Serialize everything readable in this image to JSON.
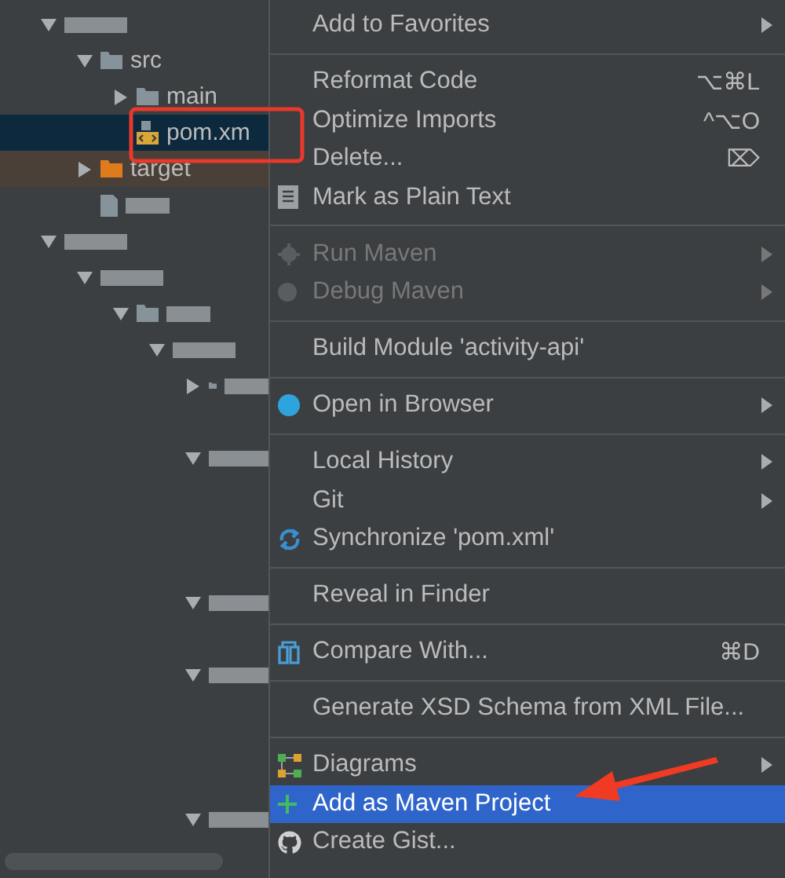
{
  "project_tree": [
    {
      "kind": "redacted",
      "expanded": true,
      "selected": false,
      "children": [
        {
          "kind": "folder",
          "label": "src",
          "expanded": true,
          "selected": false,
          "children": [
            {
              "kind": "folder",
              "label": "main",
              "expanded": false,
              "selected": false
            },
            {
              "kind": "maven-file",
              "label": "pom.xm",
              "selected": true
            }
          ]
        },
        {
          "kind": "excluded-folder",
          "label": "target",
          "expanded": false,
          "selected": false
        },
        {
          "kind": "redacted-file",
          "selected": false
        }
      ]
    },
    {
      "kind": "redacted",
      "expanded": true,
      "selected": false,
      "children": [
        {
          "kind": "redacted",
          "expanded": true,
          "selected": false,
          "children": [
            {
              "kind": "redacted-folder",
              "expanded": true,
              "selected": false,
              "children": [
                {
                  "kind": "redacted",
                  "expanded": true,
                  "selected": false,
                  "children": [
                    {
                      "kind": "redacted-folder",
                      "expanded": false,
                      "selected": false
                    },
                    {
                      "selected": false
                    },
                    {
                      "kind": "redacted",
                      "expanded": true,
                      "selected": false,
                      "children": [
                        {
                          "selected": false
                        },
                        {
                          "selected": false
                        },
                        {
                          "selected": false
                        }
                      ]
                    },
                    {
                      "kind": "redacted",
                      "expanded": true,
                      "selected": false,
                      "children": [
                        {
                          "selected": false
                        }
                      ]
                    },
                    {
                      "kind": "redacted",
                      "expanded": true,
                      "selected": false,
                      "children": [
                        {
                          "selected": false
                        },
                        {
                          "selected": false
                        },
                        {
                          "selected": false
                        }
                      ]
                    },
                    {
                      "kind": "redacted",
                      "expanded": true,
                      "selected": false
                    }
                  ]
                }
              ]
            }
          ]
        }
      ]
    }
  ],
  "context_menu": [
    {
      "kind": "item",
      "label": "Add to Favorites",
      "submenu": true,
      "disabled": false,
      "selected": false
    },
    {
      "kind": "separator"
    },
    {
      "kind": "item",
      "label": "Reformat Code",
      "shortcut": "⌥⌘L",
      "disabled": false,
      "selected": false
    },
    {
      "kind": "item",
      "label": "Optimize Imports",
      "shortcut": "^⌥O",
      "disabled": false,
      "selected": false
    },
    {
      "kind": "item",
      "label": "Delete...",
      "shortcut": "⌦",
      "disabled": false,
      "selected": false
    },
    {
      "kind": "item",
      "label": "Mark as Plain Text",
      "disabled": false,
      "selected": false
    },
    {
      "kind": "separator"
    },
    {
      "kind": "item",
      "label": "Run Maven",
      "submenu": true,
      "disabled": true,
      "selected": false
    },
    {
      "kind": "item",
      "label": "Debug Maven",
      "submenu": true,
      "disabled": true,
      "selected": false
    },
    {
      "kind": "separator"
    },
    {
      "kind": "item",
      "label": "Build Module 'activity-api'",
      "disabled": false,
      "selected": false
    },
    {
      "kind": "separator"
    },
    {
      "kind": "item",
      "label": "Open in Browser",
      "submenu": true,
      "disabled": false,
      "selected": false
    },
    {
      "kind": "separator"
    },
    {
      "kind": "item",
      "label": "Local History",
      "submenu": true,
      "disabled": false,
      "selected": false
    },
    {
      "kind": "item",
      "label": "Git",
      "submenu": true,
      "disabled": false,
      "selected": false
    },
    {
      "kind": "item",
      "label": "Synchronize 'pom.xml'",
      "disabled": false,
      "selected": false
    },
    {
      "kind": "separator"
    },
    {
      "kind": "item",
      "label": "Reveal in Finder",
      "disabled": false,
      "selected": false
    },
    {
      "kind": "separator"
    },
    {
      "kind": "item",
      "label": "Compare With...",
      "shortcut": "⌘D",
      "disabled": false,
      "selected": false
    },
    {
      "kind": "separator"
    },
    {
      "kind": "item",
      "label": "Generate XSD Schema from XML File...",
      "disabled": false,
      "selected": false
    },
    {
      "kind": "separator"
    },
    {
      "kind": "item",
      "label": "Diagrams",
      "submenu": true,
      "disabled": false,
      "selected": false
    },
    {
      "kind": "item",
      "label": "Add as Maven Project",
      "disabled": false,
      "selected": true
    },
    {
      "kind": "item",
      "label": "Create Gist...",
      "disabled": false,
      "selected": false
    }
  ]
}
